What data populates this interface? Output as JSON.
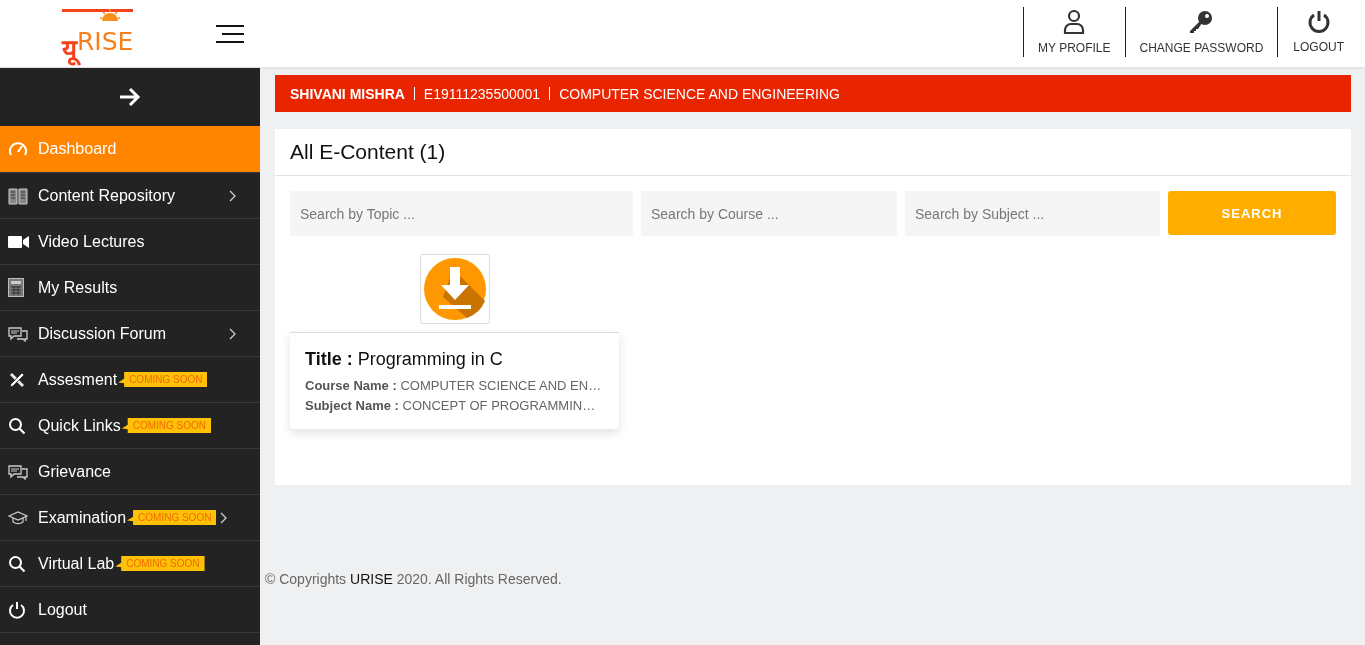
{
  "logo": {
    "mark": "यू",
    "word": "RISE"
  },
  "top_actions": [
    {
      "kind": "profile",
      "label": "MY PROFILE"
    },
    {
      "kind": "key",
      "label": "CHANGE PASSWORD"
    },
    {
      "kind": "power",
      "label": "LOGOUT"
    }
  ],
  "sidebar": {
    "items": [
      {
        "kind": "gauge",
        "label": "Dashboard",
        "selected": true,
        "has_submenu": false
      },
      {
        "kind": "book",
        "label": "Content Repository",
        "selected": false,
        "has_submenu": true
      },
      {
        "kind": "video",
        "label": "Video Lectures",
        "selected": false,
        "has_submenu": false
      },
      {
        "kind": "calculator",
        "label": "My Results",
        "selected": false,
        "has_submenu": false
      },
      {
        "kind": "chat",
        "label": "Discussion Forum",
        "selected": false,
        "has_submenu": true
      },
      {
        "kind": "tools",
        "label": "Assesment",
        "selected": false,
        "has_submenu": false,
        "badge": "COMING SOON"
      },
      {
        "kind": "search",
        "label": "Quick Links",
        "selected": false,
        "has_submenu": false,
        "badge": "COMING SOON"
      },
      {
        "kind": "chat",
        "label": "Grievance",
        "selected": false,
        "has_submenu": false
      },
      {
        "kind": "cap",
        "label": "Examination",
        "selected": false,
        "has_submenu": true,
        "badge": "COMING SOON"
      },
      {
        "kind": "search",
        "label": "Virtual Lab",
        "selected": false,
        "has_submenu": false,
        "badge": "COMING SOON"
      },
      {
        "kind": "power",
        "label": "Logout",
        "selected": false,
        "has_submenu": false
      }
    ]
  },
  "student_bar": {
    "name": "SHIVANI MISHRA",
    "enrollment": "E19111235500001",
    "branch": "COMPUTER SCIENCE AND ENGINEERING"
  },
  "panel": {
    "title": "All E-Content (1)",
    "search_fields": [
      {
        "placeholder": "Search by Topic ..."
      },
      {
        "placeholder": "Search by Course ..."
      },
      {
        "placeholder": "Search by Subject ..."
      }
    ],
    "search_button": "SEARCH",
    "items": [
      {
        "title_label": "Title :",
        "title": "Programming in C",
        "course_label": "Course Name :",
        "course": "COMPUTER SCIENCE AND EN…",
        "subject_label": "Subject Name :",
        "subject": "CONCEPT OF PROGRAMMIN…"
      }
    ]
  },
  "footer": {
    "before": "© Copyrights ",
    "brand": "URISE",
    "after": " 2020. All Rights Reserved."
  }
}
